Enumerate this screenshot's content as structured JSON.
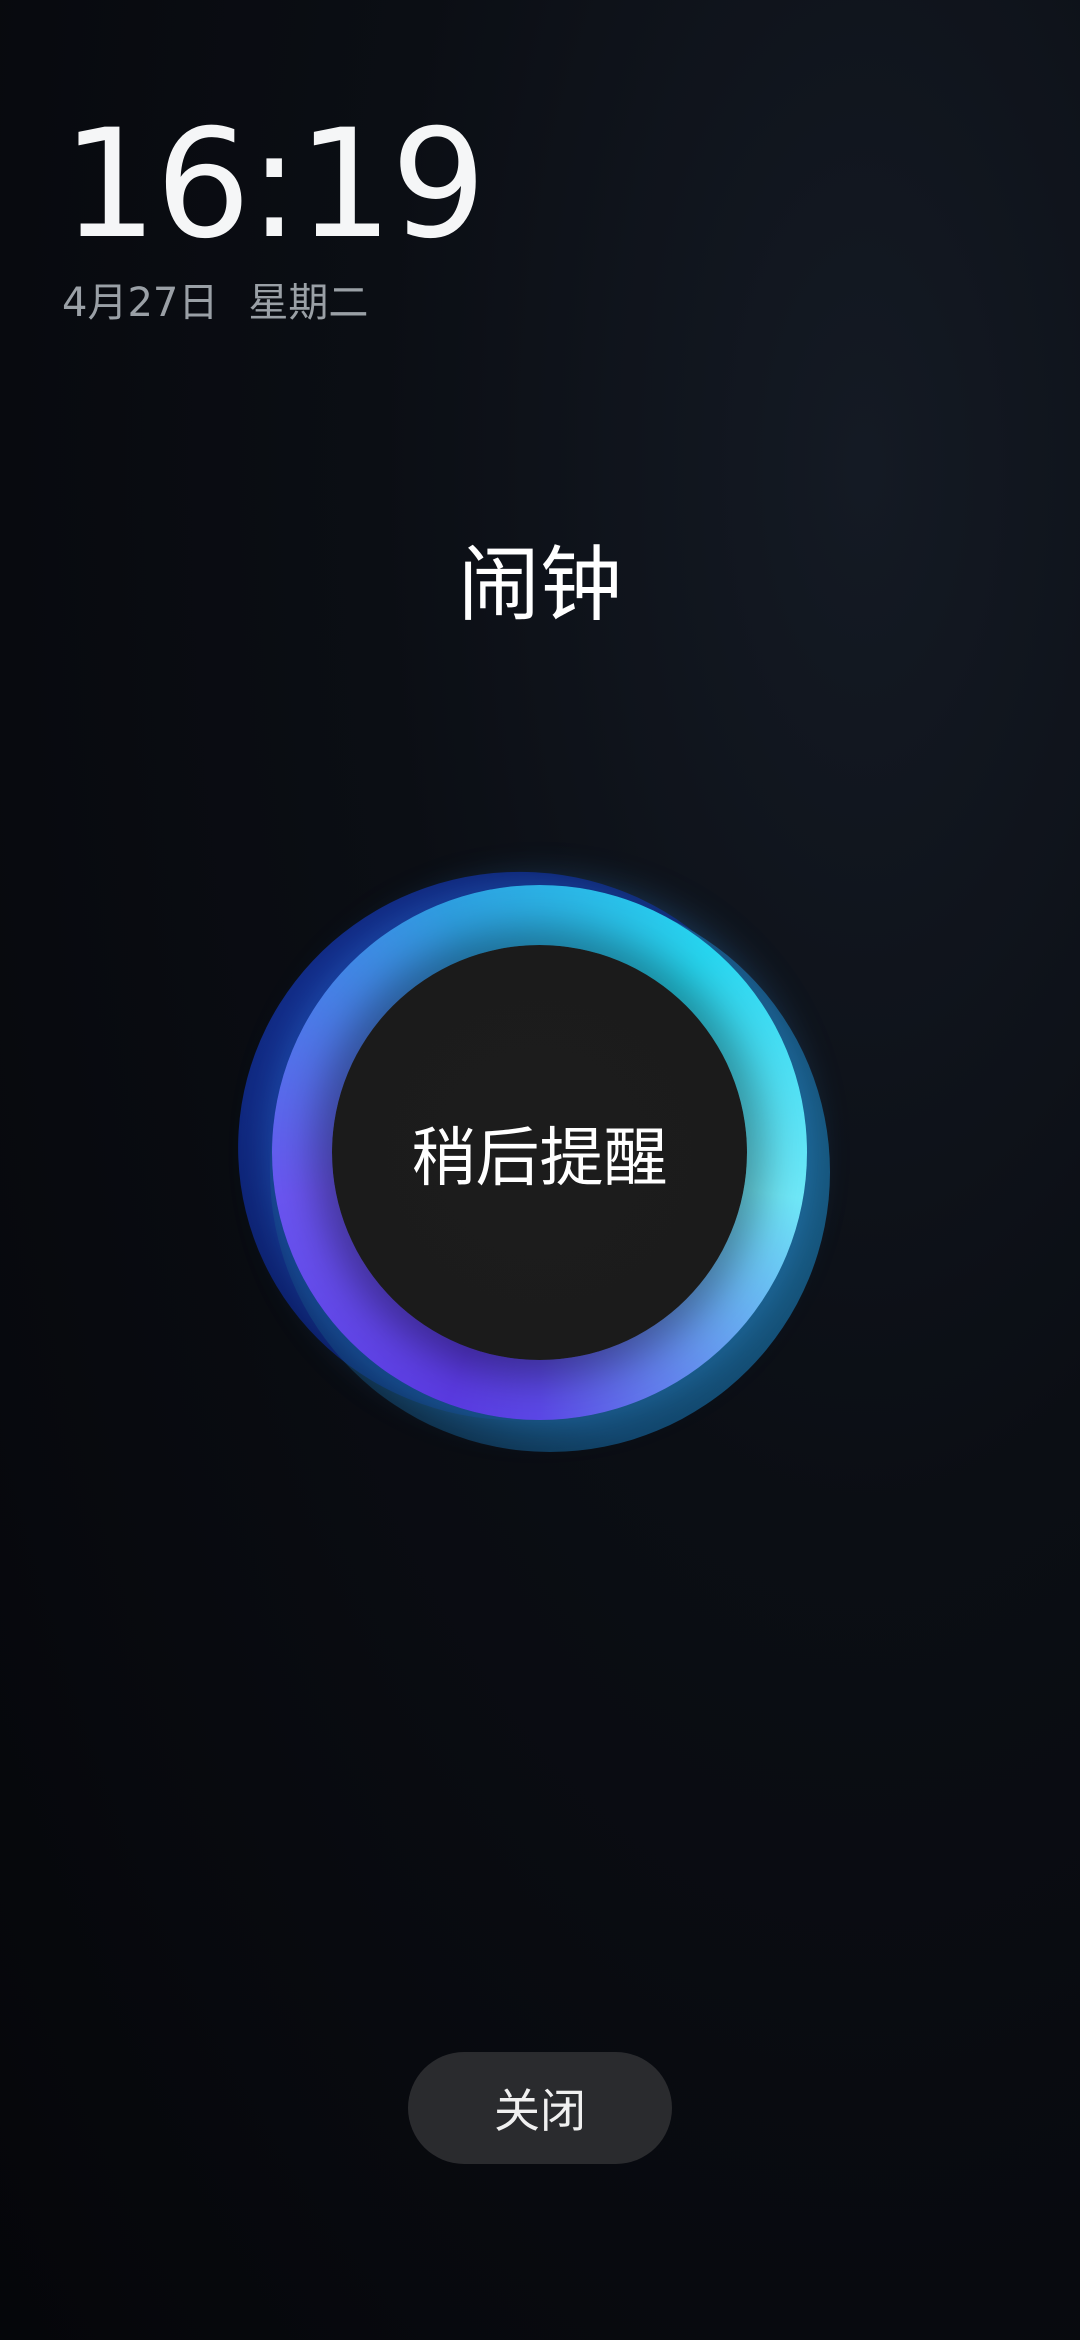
{
  "lock": {
    "time": "16:19",
    "date": "4月27日",
    "weekday": "星期二"
  },
  "alarm": {
    "title": "闹钟",
    "snooze_label": "稍后提醒",
    "close_label": "关闭"
  },
  "colors": {
    "background": "#0b0e14",
    "ring_cyan": "#27d6f0",
    "ring_purple": "#5a3ae0",
    "button_bg": "#2a2b2e"
  }
}
